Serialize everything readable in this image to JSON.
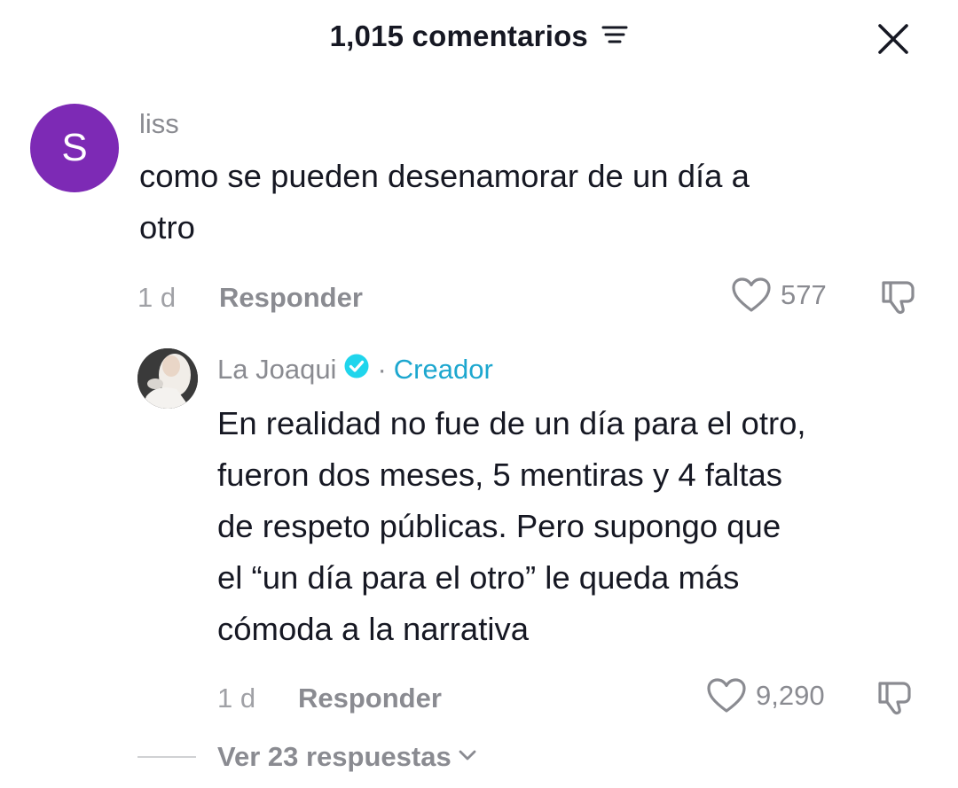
{
  "header": {
    "title": "1,015 comentarios",
    "filter_icon": "filter-lines-icon",
    "close_icon": "close-x-icon"
  },
  "comments": [
    {
      "avatar_letter": "S",
      "avatar_color": "#7d2ab5",
      "username": "liss",
      "text_lines": [
        "como se pueden desenamorar de un día a",
        "otro"
      ],
      "time": "1 d",
      "reply_label": "Responder",
      "likes": "577"
    },
    {
      "username": "La Joaqui",
      "badge": "Creador",
      "badge_color": "#1da7cf",
      "separator": "·",
      "text_lines": [
        "En realidad no fue de un día para el otro,",
        "fueron dos meses, 5 mentiras y 4 faltas",
        "de respeto públicas. Pero supongo que",
        "el “un día para el otro” le queda más",
        "cómoda a la narrativa"
      ],
      "time": "1 d",
      "reply_label": "Responder",
      "likes": "9,290"
    }
  ],
  "view_replies": "Ver 23 respuestas"
}
